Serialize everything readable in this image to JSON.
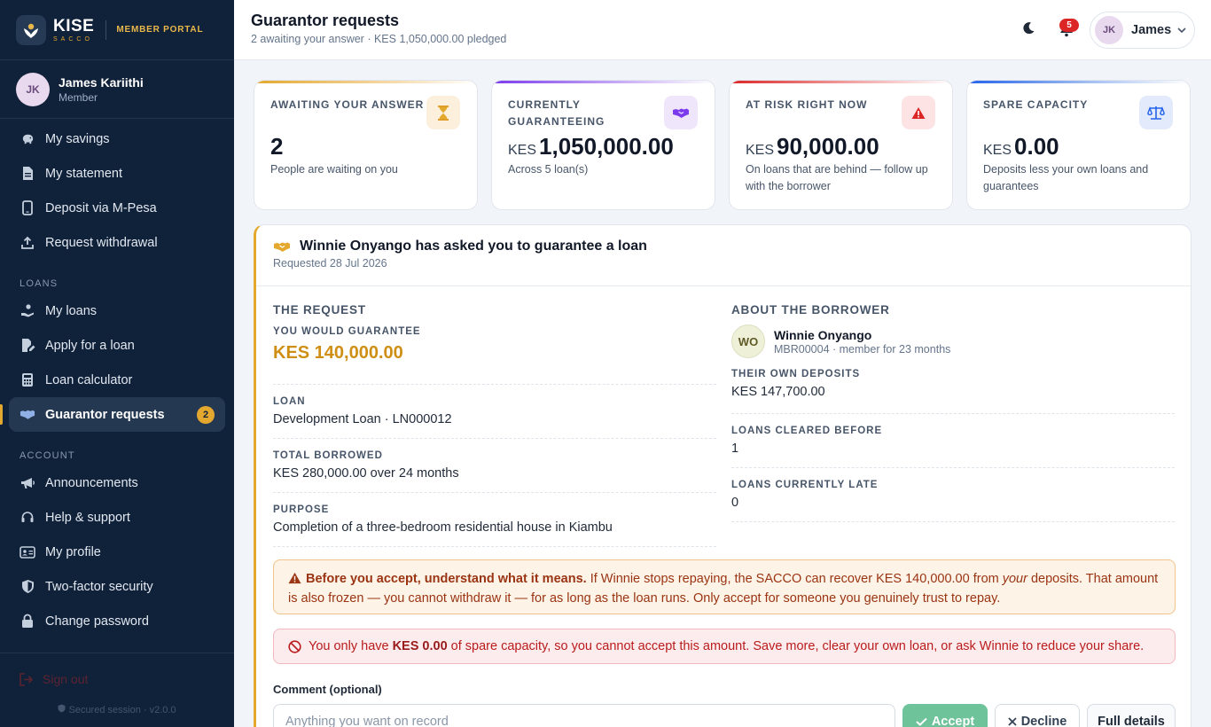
{
  "brand": {
    "name": "KISE",
    "sub": "SACCO",
    "portal": "MEMBER PORTAL"
  },
  "user": {
    "initials": "JK",
    "name": "James Kariithi",
    "role": "Member",
    "short_name": "James"
  },
  "nav": {
    "top_items": [
      {
        "label": "My savings",
        "icon": "piggy-bank-icon"
      },
      {
        "label": "My statement",
        "icon": "document-icon"
      },
      {
        "label": "Deposit via M-Pesa",
        "icon": "phone-icon"
      },
      {
        "label": "Request withdrawal",
        "icon": "upload-icon"
      }
    ],
    "loans_section": "LOANS",
    "loans_items": [
      {
        "label": "My loans",
        "icon": "hand-coin-icon"
      },
      {
        "label": "Apply for a loan",
        "icon": "edit-file-icon"
      },
      {
        "label": "Loan calculator",
        "icon": "calculator-icon"
      },
      {
        "label": "Guarantor requests",
        "icon": "handshake-icon",
        "badge": "2",
        "active": true
      }
    ],
    "account_section": "ACCOUNT",
    "account_items": [
      {
        "label": "Announcements",
        "icon": "megaphone-icon"
      },
      {
        "label": "Help & support",
        "icon": "headset-icon"
      },
      {
        "label": "My profile",
        "icon": "id-card-icon"
      },
      {
        "label": "Two-factor security",
        "icon": "shield-icon"
      },
      {
        "label": "Change password",
        "icon": "lock-icon"
      }
    ],
    "sign_out": "Sign out",
    "secured": "Secured session · v2.0.0"
  },
  "header": {
    "title": "Guarantor requests",
    "subtitle": "2 awaiting your answer · KES 1,050,000.00 pledged",
    "notifications": "5"
  },
  "stats": [
    {
      "label": "AWAITING YOUR ANSWER",
      "currency": "",
      "value": "2",
      "note": "People are waiting on you",
      "icon": "hourglass-icon",
      "accent": "#e4a82e"
    },
    {
      "label": "CURRENTLY GUARANTEEING",
      "currency": "KES",
      "value": "1,050,000.00",
      "note": "Across 5 loan(s)",
      "icon": "handshake-icon",
      "accent": "#7c3aed"
    },
    {
      "label": "AT RISK RIGHT NOW",
      "currency": "KES",
      "value": "90,000.00",
      "note": "On loans that are behind — follow up with the borrower",
      "icon": "warning-icon",
      "accent": "#dc2626"
    },
    {
      "label": "SPARE CAPACITY",
      "currency": "KES",
      "value": "0.00",
      "note": "Deposits less your own loans and guarantees",
      "icon": "scale-icon",
      "accent": "#2563eb"
    }
  ],
  "request": {
    "title": "Winnie Onyango has asked you to guarantee a loan",
    "requested": "Requested 28 Jul 2026",
    "left_heading": "THE REQUEST",
    "guarantee_label": "YOU WOULD GUARANTEE",
    "guarantee_amount": "KES 140,000.00",
    "loan_label": "LOAN",
    "loan_value": "Development Loan · LN000012",
    "total_label": "TOTAL BORROWED",
    "total_value": "KES 280,000.00 over 24 months",
    "purpose_label": "PURPOSE",
    "purpose_value": "Completion of a three-bedroom residential house in Kiambu",
    "right_heading": "ABOUT THE BORROWER",
    "borrower_initials": "WO",
    "borrower_name": "Winnie Onyango",
    "borrower_sub": "MBR00004 · member for 23 months",
    "deposits_label": "THEIR OWN DEPOSITS",
    "deposits_value": "KES 147,700.00",
    "cleared_label": "LOANS CLEARED BEFORE",
    "cleared_value": "1",
    "late_label": "LOANS CURRENTLY LATE",
    "late_value": "0",
    "warn_bold": "Before you accept, understand what it means.",
    "warn_text_1": " If Winnie stops repaying, the SACCO can recover KES 140,000.00 from ",
    "warn_italic": "your",
    "warn_text_2": " deposits. That amount is also frozen — you cannot withdraw it — for as long as the loan runs. Only accept for someone you genuinely trust to repay.",
    "err_text_1": "You only have",
    "err_bold": "KES 0.00",
    "err_text_2": "of spare capacity, so you cannot accept this amount. Save more, clear your own loan, or ask Winnie to reduce your share.",
    "comment_label": "Comment (optional)",
    "comment_placeholder": "Anything you want on record",
    "comment_value": "",
    "accept_label": "Accept",
    "decline_label": "Decline",
    "details_label": "Full details"
  }
}
